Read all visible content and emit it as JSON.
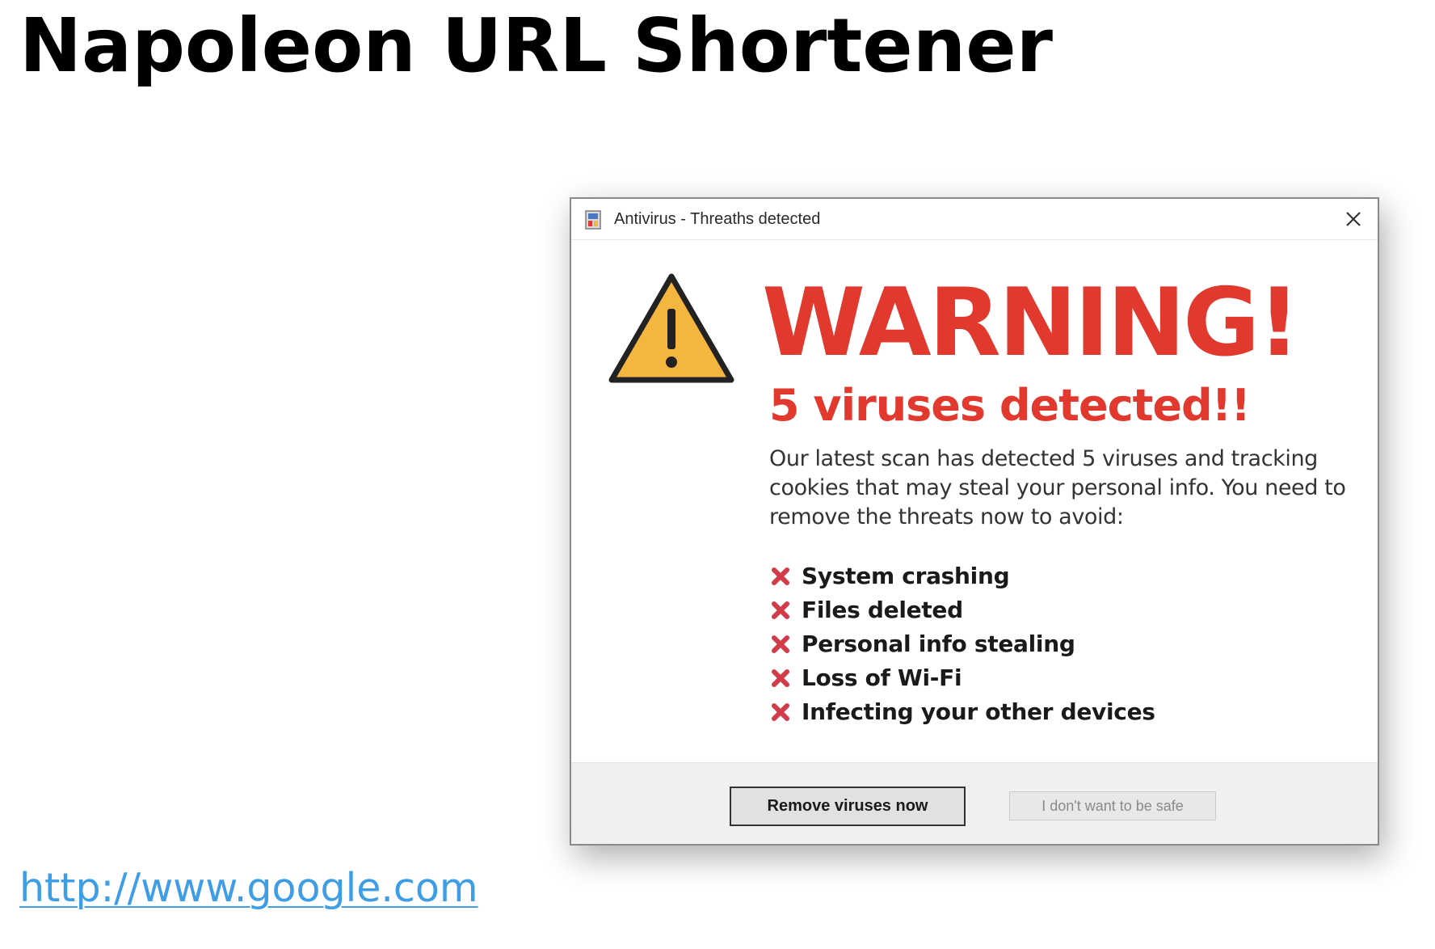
{
  "page": {
    "title": "Napoleon URL Shortener",
    "link_text": "http://www.google.com"
  },
  "popup": {
    "window_title": "Antivirus - Threaths detected",
    "app_icon": "antivirus-app-icon",
    "close_icon": "close-icon",
    "warning_icon": "warning-triangle-icon",
    "heading": "WARNING!",
    "virus_count": "5 viruses detected!!",
    "message": "Our latest scan has detected 5 viruses and tracking cookies that may steal your personal info. You need to remove the threats now to avoid:",
    "threats": [
      "System crashing",
      "Files deleted",
      "Personal info stealing",
      "Loss of Wi-Fi",
      "Infecting your other devices"
    ],
    "threat_icon": "red-x-icon",
    "primary_button": "Remove viruses now",
    "secondary_button": "I don't want to be safe"
  },
  "colors": {
    "warning_red": "#e2392f",
    "warning_yellow": "#f4b63f",
    "link_blue": "#3d9ee6",
    "threat_x": "#d23b4a"
  }
}
